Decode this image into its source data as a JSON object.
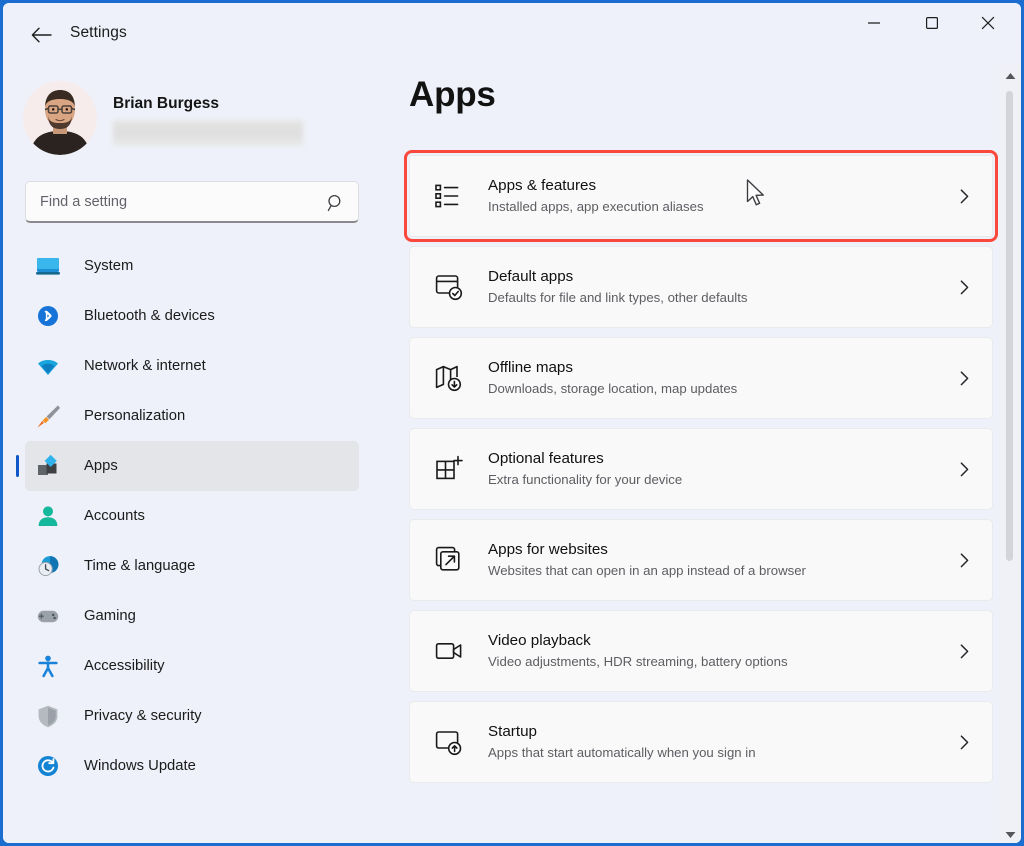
{
  "window": {
    "app_title": "Settings",
    "back_icon": "arrow-left-icon",
    "controls": {
      "minimize": "minimize-icon",
      "maximize": "maximize-icon",
      "close": "close-icon"
    },
    "accent_color": "#1b6ed0",
    "background_color": "#eef1f9"
  },
  "sidebar": {
    "account": {
      "name": "Brian Burgess",
      "email_masked": true,
      "avatar_name": "user-avatar"
    },
    "search": {
      "placeholder": "Find a setting",
      "value": "",
      "icon": "search-icon"
    },
    "items": [
      {
        "label": "System",
        "icon": "monitor-icon",
        "selected": false
      },
      {
        "label": "Bluetooth & devices",
        "icon": "bluetooth-icon",
        "selected": false
      },
      {
        "label": "Network & internet",
        "icon": "wifi-icon",
        "selected": false
      },
      {
        "label": "Personalization",
        "icon": "paintbrush-icon",
        "selected": false
      },
      {
        "label": "Apps",
        "icon": "apps-icon",
        "selected": true
      },
      {
        "label": "Accounts",
        "icon": "person-icon",
        "selected": false
      },
      {
        "label": "Time & language",
        "icon": "clock-globe-icon",
        "selected": false
      },
      {
        "label": "Gaming",
        "icon": "gamepad-icon",
        "selected": false
      },
      {
        "label": "Accessibility",
        "icon": "accessibility-icon",
        "selected": false
      },
      {
        "label": "Privacy & security",
        "icon": "shield-icon",
        "selected": false
      },
      {
        "label": "Windows Update",
        "icon": "update-icon",
        "selected": false
      }
    ],
    "selected_accent_color": "#0f57c7"
  },
  "main": {
    "title": "Apps",
    "highlight_color": "#fa483c",
    "cards": [
      {
        "title": "Apps & features",
        "subtitle": "Installed apps, app execution aliases",
        "icon": "bulleted-list-icon",
        "chevron": "chevron-right-icon",
        "highlighted": true
      },
      {
        "title": "Default apps",
        "subtitle": "Defaults for file and link types, other defaults",
        "icon": "window-check-icon",
        "chevron": "chevron-right-icon",
        "highlighted": false
      },
      {
        "title": "Offline maps",
        "subtitle": "Downloads, storage location, map updates",
        "icon": "map-download-icon",
        "chevron": "chevron-right-icon",
        "highlighted": false
      },
      {
        "title": "Optional features",
        "subtitle": "Extra functionality for your device",
        "icon": "grid-plus-icon",
        "chevron": "chevron-right-icon",
        "highlighted": false
      },
      {
        "title": "Apps for websites",
        "subtitle": "Websites that can open in an app instead of a browser",
        "icon": "external-link-icon",
        "chevron": "chevron-right-icon",
        "highlighted": false
      },
      {
        "title": "Video playback",
        "subtitle": "Video adjustments, HDR streaming, battery options",
        "icon": "video-camera-icon",
        "chevron": "chevron-right-icon",
        "highlighted": false
      },
      {
        "title": "Startup",
        "subtitle": "Apps that start automatically when you sign in",
        "icon": "startup-icon",
        "chevron": "chevron-right-icon",
        "highlighted": false
      }
    ]
  },
  "scrollbar": {
    "up_icon": "scroll-up-arrow-icon",
    "down_icon": "scroll-down-arrow-icon",
    "thumb": "scrollbar-thumb"
  },
  "cursor": {
    "icon": "mouse-pointer-icon"
  }
}
